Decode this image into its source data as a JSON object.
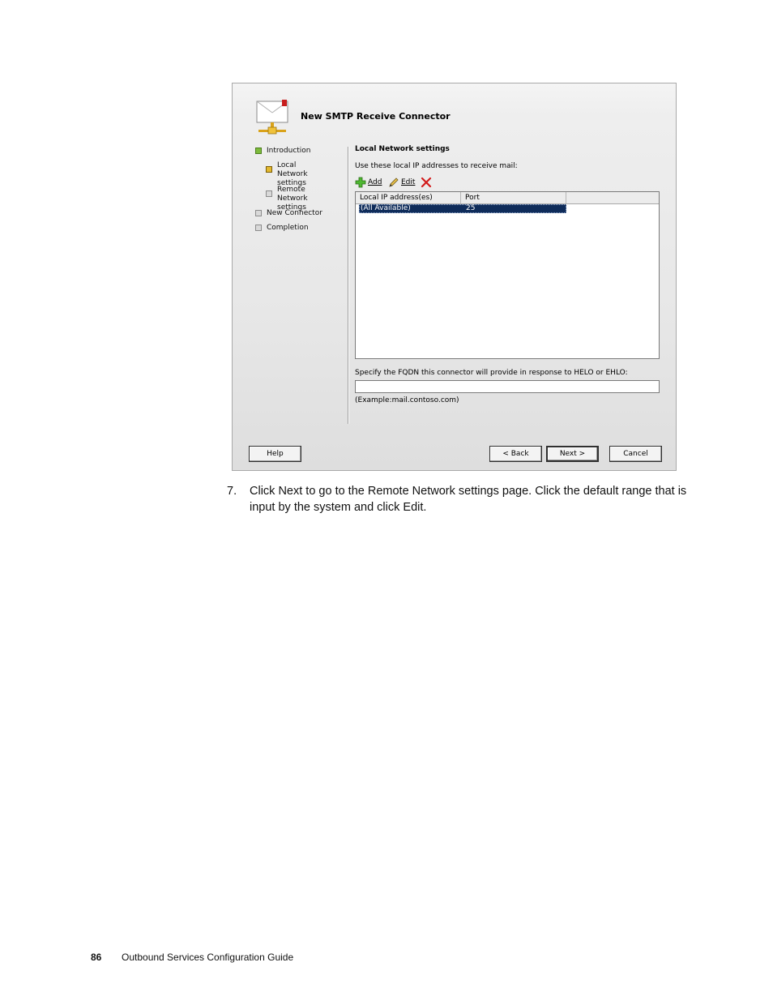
{
  "wizard": {
    "title": "New SMTP Receive Connector",
    "nav": [
      {
        "label": "Introduction",
        "state": "done"
      },
      {
        "label": "Local Network\nsettings",
        "state": "current"
      },
      {
        "label": "Remote Network\nsettings",
        "state": "pending"
      },
      {
        "label": "New Connector",
        "state": "pending"
      },
      {
        "label": "Completion",
        "state": "pending"
      }
    ],
    "section_heading": "Local Network settings",
    "instruction": "Use these local IP addresses to receive mail:",
    "toolbar": {
      "add_label": "Add",
      "edit_label": "Edit",
      "add_icon": "add-icon",
      "edit_icon": "pencil-icon",
      "remove_icon": "remove-x-icon"
    },
    "list": {
      "columns": [
        "Local IP address(es)",
        "Port"
      ],
      "rows": [
        {
          "ip": "(All Available)",
          "port": "25",
          "selected": true
        }
      ]
    },
    "fqdn_label": "Specify the FQDN this connector will provide in response to HELO or EHLO:",
    "fqdn_value": "",
    "fqdn_example": "(Example:mail.contoso.com)",
    "buttons": {
      "help": "Help",
      "back": "< Back",
      "next": "Next >",
      "cancel": "Cancel"
    },
    "colors": {
      "selection": "#0f2c5a",
      "done_box": "#7dbb3c",
      "current_box": "#e3b92f"
    }
  },
  "document": {
    "step_number": "7.",
    "step_text": "Click Next to go to the Remote Network settings page. Click the default range that is input by the system and click Edit."
  },
  "footer": {
    "page_number": "86",
    "guide_title": "Outbound Services Configuration Guide"
  }
}
